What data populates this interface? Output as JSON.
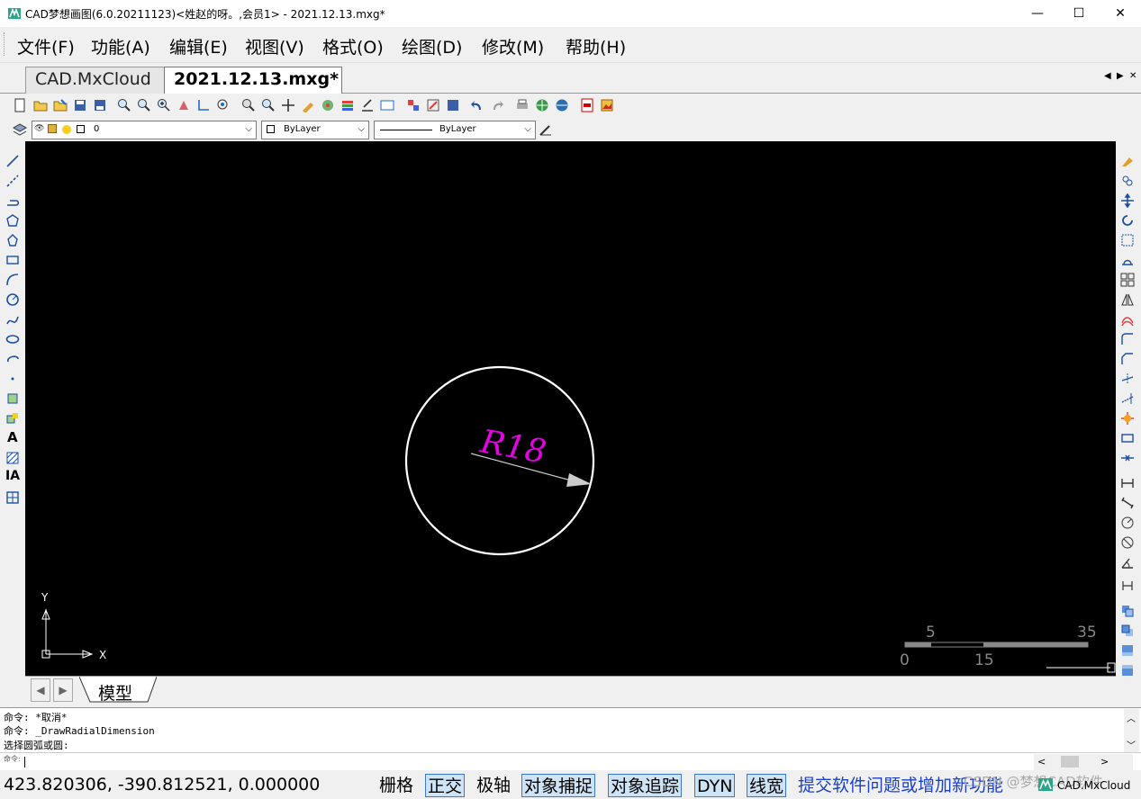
{
  "window": {
    "title": "CAD梦想画图(6.0.20211123)<姓赵的呀。,会员1> - 2021.12.13.mxg*",
    "minimize": "—",
    "maximize": "☐",
    "close": "✕"
  },
  "menu": [
    "文件(F)",
    "功能(A)",
    "编辑(E)",
    "视图(V)",
    "格式(O)",
    "绘图(D)",
    "修改(M)",
    "帮助(H)"
  ],
  "tabs": [
    {
      "label": "CAD.MxCloud"
    },
    {
      "label": "2021.12.13.mxg*"
    }
  ],
  "tab_nav": {
    "left": "◀",
    "right": "▶",
    "close": "✕"
  },
  "layer_bar": {
    "layer_value": "0",
    "color_value": "ByLayer",
    "linetype_value": "ByLayer"
  },
  "drawing": {
    "dimension_text": "R18",
    "circle_color": "#ffffff",
    "dimension_color": "#e600e6",
    "ucs_y": "Y",
    "ucs_x": "X",
    "scale_labels": [
      "5",
      "35",
      "0",
      "15"
    ]
  },
  "model_tab": {
    "label": "模型"
  },
  "command": {
    "lines": [
      "命令:  *取消*",
      "命令: _DrawRadialDimension",
      " 选择圆弧或圆:"
    ],
    "prompt": "命令:"
  },
  "status": {
    "coords": "423.820306,  -390.812521,  0.000000",
    "buttons": [
      {
        "label": "栅格",
        "on": false
      },
      {
        "label": "正交",
        "on": true
      },
      {
        "label": "极轴",
        "on": false
      },
      {
        "label": "对象捕捉",
        "on": true
      },
      {
        "label": "对象追踪",
        "on": true
      },
      {
        "label": "DYN",
        "on": true
      },
      {
        "label": "线宽",
        "on": true
      }
    ],
    "feedback": "提交软件问题或增加新功能",
    "brand": "CAD.MxCloud",
    "watermark": "CSDN @梦想CAD软件"
  }
}
